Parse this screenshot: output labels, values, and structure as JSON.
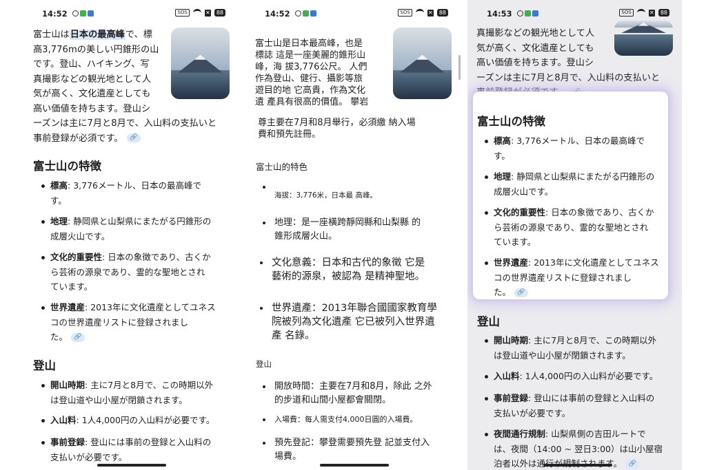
{
  "status": {
    "p1_time": "14:52",
    "p2_time": "14:52",
    "p3_time": "14:53",
    "sos": "SOS",
    "x": "✕",
    "battery": "88"
  },
  "icons": {
    "info": "info-icon",
    "app": "app-icon",
    "signal": "wifi-icon",
    "sos": "sos-icon",
    "x": "x-icon",
    "battery": "battery-icon",
    "link": "link-icon",
    "image": "mount-fuji-image"
  },
  "colors": {
    "highlight": "#dbe6fb",
    "chip": "#dde7f8",
    "chip_text": "#3e6db5",
    "glow": "#cdb4eb"
  },
  "p1": {
    "intro_pre": "富士山は",
    "intro_hl": "日本の最高峰",
    "intro_lines": [
      "で、標",
      "高3,776mの美しい円錐形の山",
      "です。登山、ハイキング、写",
      "真撮影などの観光地として人",
      "気が高く、文化遺産としても",
      "高い価値を持ちます。登山シ",
      "ーズンは主に7月と8月で、入山料の支払いと",
      "事前登録が必須です。"
    ],
    "section1": "富士山の特徴",
    "features": [
      {
        "label": "標高",
        "text_lines": [
          ": 3,776メートル、日本の最高峰で",
          "す。"
        ]
      },
      {
        "label": "地理",
        "text_lines": [
          ": 静岡県と山梨県にまたがる円錐形の",
          "成層火山です。"
        ]
      },
      {
        "label": "文化的重要性",
        "text_lines": [
          ": 日本の象徴であり、古くか",
          "ら芸術の源泉であり、霊的な聖地とされ",
          "ています。"
        ]
      },
      {
        "label": "世界遺産",
        "text_lines": [
          ": 2013年に文化遺産としてユネス",
          "コの世界遺産リストに登録されまし",
          "た。"
        ]
      }
    ],
    "section2": "登山",
    "climbing": [
      {
        "label": "開山時期",
        "text_lines": [
          ": 主に7月と8月で、この時期以外",
          "は登山道や山小屋が閉鎖されます。"
        ]
      },
      {
        "label": "入山料",
        "text_lines": [
          ": 1人4,000円の入山料が必要です。"
        ]
      },
      {
        "label": "事前登録",
        "text_lines": [
          ": 登山には事前の登録と入山料の",
          "支払いが必要です。"
        ]
      }
    ]
  },
  "p2": {
    "intro_lines": [
      "富士山是日本最高峰，也是",
      "標誌 這是一座美麗的錐形山",
      "峰，海 拔3,776公尺。 人們",
      "作為登山、健行、攝影等旅",
      "遊目的地 它高貴，作為文化",
      "遺 產具有很高的價值。 攀岩"
    ],
    "intro_cont": [
      "尊主要在7月和8月舉行，必須繳 納入場",
      "費和預先註冊。"
    ],
    "section1": "富士山的特色",
    "features": [
      [
        "海拔：3,776米，日本最 高峰。"
      ],
      [
        "地理：是一座橫跨靜岡縣和山梨縣 的",
        "錐形成層火山。"
      ],
      [
        "文化意義：日本和古代的象徵 它是",
        "藝術的源泉，被認為 是精神聖地。"
      ],
      [
        "世界遺產：2013年聯合國國家教育學",
        "院被列為文化遺產 它已被列入世界遺",
        "產 名錄。"
      ]
    ],
    "section2": "登山",
    "climbing": [
      [
        "開放時間：主要在7月和8月，除此 之外",
        "的步道和山間小屋都會關閉。"
      ],
      [
        "入場費：每人需支付4,000日圓的入場費。"
      ],
      [
        "預先登記：攀登需要預先登 記並支付入",
        "場費。"
      ]
    ]
  },
  "p3": {
    "intro_lines": [
      "真撮影などの観光地として人",
      "気が高く、文化遺産としても",
      "高い価値を持ちます。登山シ",
      "ーズンは主に7月と8月で、入山料の支払いと",
      "事前登録が必須です。"
    ],
    "section1": "富士山の特徴",
    "features": [
      {
        "label": "標高",
        "text_lines": [
          ": 3,776メートル、日本の最高峰で",
          "す。"
        ]
      },
      {
        "label": "地理",
        "text_lines": [
          ": 静岡県と山梨県にまたがる円錐形の",
          "成層火山です。"
        ]
      },
      {
        "label": "文化的重要性",
        "text_lines": [
          ": 日本の象徴であり、古くか",
          "ら芸術の源泉であり、霊的な聖地とされ",
          "ています。"
        ]
      },
      {
        "label": "世界遺産",
        "text_lines": [
          ": 2013年に文化遺産としてユネス",
          "コの世界遺産リストに登録されまし",
          "た。"
        ]
      }
    ],
    "section2": "登山",
    "climbing": [
      {
        "label": "開山時期",
        "text_lines": [
          ": 主に7月と8月で、この時期以外",
          "は登山道や山小屋が閉鎖されます。"
        ]
      },
      {
        "label": "入山料",
        "text_lines": [
          ": 1人4,000円の入山料が必要です。"
        ]
      },
      {
        "label": "事前登録",
        "text_lines": [
          ": 登山には事前の登録と入山料の",
          "支払いが必要です。"
        ]
      },
      {
        "label": "夜間通行規制",
        "text_lines": [
          ": 山梨県側の吉田ルートで",
          "は、夜間（14:00 ~ 翌日3:00）は山小屋宿",
          "泊者以外は通行が規制されます。"
        ]
      }
    ]
  }
}
